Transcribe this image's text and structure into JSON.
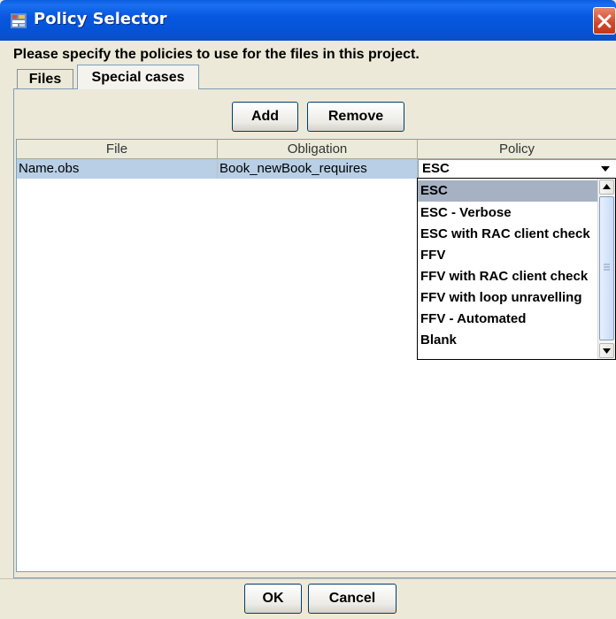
{
  "window": {
    "title": "Policy Selector"
  },
  "instruction": "Please specify the policies to use for the files in this project.",
  "tabs": [
    {
      "label": "Files",
      "active": false
    },
    {
      "label": "Special cases",
      "active": true
    }
  ],
  "buttons": {
    "add": "Add",
    "remove": "Remove",
    "ok": "OK",
    "cancel": "Cancel"
  },
  "table": {
    "columns": [
      "File",
      "Obligation",
      "Policy"
    ],
    "rows": [
      {
        "file": "Name.obs",
        "obligation": "Book_newBook_requires",
        "policy": "ESC"
      }
    ]
  },
  "dropdown": {
    "options": [
      "ESC",
      "ESC - Verbose",
      "ESC with RAC client check",
      "FFV",
      "FFV with RAC client check",
      "FFV with loop unravelling",
      "FFV - Automated",
      "Blank"
    ],
    "selected": "ESC"
  },
  "colors": {
    "titlebar": "#0554d8",
    "selection": "#b8cfe5",
    "dropdown_highlight": "#a6b2c3"
  }
}
